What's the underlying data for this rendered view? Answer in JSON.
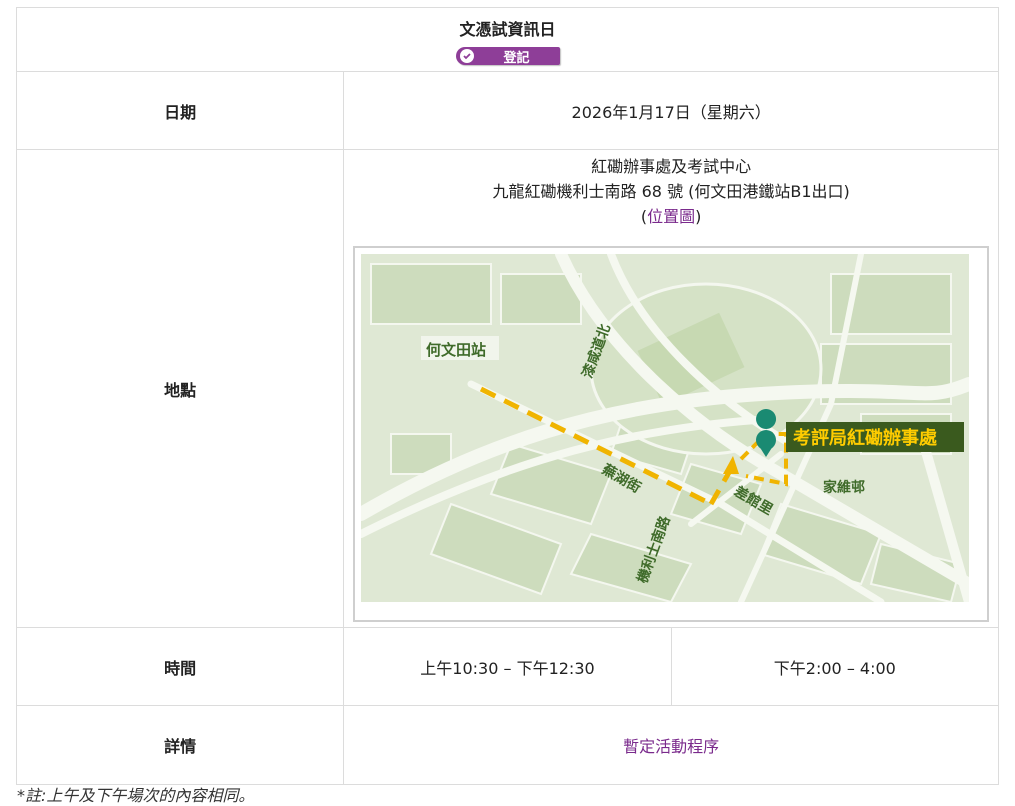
{
  "header": {
    "title": "文憑試資訊日",
    "register_label": "登記"
  },
  "rows": {
    "date": {
      "label": "日期",
      "value": "2026年1月17日（星期六）"
    },
    "location": {
      "label": "地點",
      "line1": "紅磡辦事處及考試中心",
      "line2": "九龍紅磡機利士南路 68 號 (何文田港鐵站B1出口)",
      "paren_open": "(",
      "map_link": "位置圖",
      "paren_close": ")"
    },
    "time": {
      "label": "時間",
      "morning": "上午10:30 – 下午12:30",
      "afternoon": "下午2:00 – 4:00"
    },
    "details": {
      "label": "詳情",
      "link": "暫定活動程序"
    }
  },
  "map": {
    "station": "何文田站",
    "road_1": "漆咸道北",
    "road_2": "蕪湖街",
    "road_3": "機利士南路",
    "road_4": "差館里",
    "office": "考評局紅磡辦事處",
    "estate": "家維邨",
    "colors": {
      "route": "#f0b400",
      "pin": "#1a8a72",
      "label_bg": "#3a5a1e",
      "label_text": "#ffcc00",
      "road_text": "#3f6b2a"
    }
  },
  "note": "*註:上午及下午場次的內容相同。"
}
